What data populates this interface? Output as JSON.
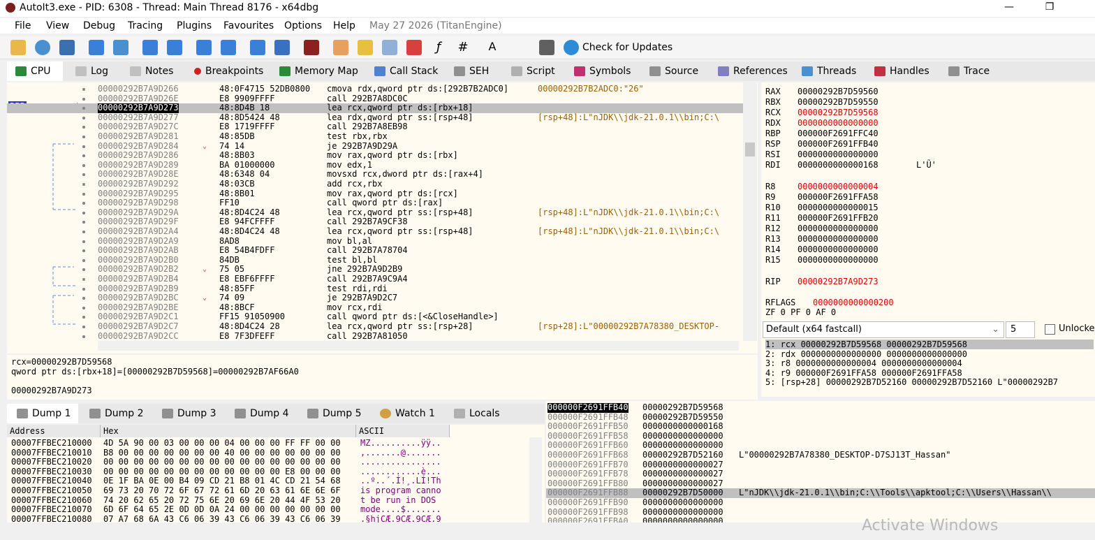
{
  "window": {
    "title": "AutoIt3.exe - PID: 6308 - Thread: Main Thread 8176 - x64dbg",
    "minimize": "—",
    "restore": "❐",
    "close": "✕"
  },
  "menu": [
    "File",
    "View",
    "Debug",
    "Tracing",
    "Plugins",
    "Favourites",
    "Options",
    "Help"
  ],
  "build_info": "May 27 2026 (TitanEngine)",
  "toolbar": {
    "check_updates": "Check for Updates"
  },
  "tabs": [
    "CPU",
    "Log",
    "Notes",
    "Breakpoints",
    "Memory Map",
    "Call Stack",
    "SEH",
    "Script",
    "Symbols",
    "Source",
    "References",
    "Threads",
    "Handles",
    "Trace"
  ],
  "rip_label": "RIP",
  "disasm": [
    {
      "addr": "00000292B7A9D266",
      "bytes": "48:0F4715 52DB0800",
      "ins": "cmova rdx,qword ptr ds:[292B7B2ADC0]",
      "cmt": "00000292B7B2ADC0:\"26\""
    },
    {
      "addr": "00000292B7A9D26E",
      "bytes": "E8 9909FFFF",
      "ins": "call 292B7A8DC0C",
      "cmt": ""
    },
    {
      "addr": "00000292B7A9D273",
      "bytes": "48:8D4B 18",
      "ins": "lea rcx,qword ptr ds:[rbx+18]",
      "cmt": ""
    },
    {
      "addr": "00000292B7A9D277",
      "bytes": "48:8D5424 48",
      "ins": "lea rdx,qword ptr ss:[rsp+48]",
      "cmt": "[rsp+48]:L\"nJDK\\\\jdk-21.0.1\\\\bin;C:\\"
    },
    {
      "addr": "00000292B7A9D27C",
      "bytes": "E8 1719FFFF",
      "ins": "call 292B7A8EB98",
      "cmt": ""
    },
    {
      "addr": "00000292B7A9D281",
      "bytes": "48:85DB",
      "ins": "test rbx,rbx",
      "cmt": ""
    },
    {
      "addr": "00000292B7A9D284",
      "bytes": "74 14",
      "ins": "je 292B7A9D29A",
      "cmt": ""
    },
    {
      "addr": "00000292B7A9D286",
      "bytes": "48:8B03",
      "ins": "mov rax,qword ptr ds:[rbx]",
      "cmt": ""
    },
    {
      "addr": "00000292B7A9D289",
      "bytes": "BA 01000000",
      "ins": "mov edx,1",
      "cmt": ""
    },
    {
      "addr": "00000292B7A9D28E",
      "bytes": "48:6348 04",
      "ins": "movsxd rcx,dword ptr ds:[rax+4]",
      "cmt": ""
    },
    {
      "addr": "00000292B7A9D292",
      "bytes": "48:03CB",
      "ins": "add rcx,rbx",
      "cmt": ""
    },
    {
      "addr": "00000292B7A9D295",
      "bytes": "48:8B01",
      "ins": "mov rax,qword ptr ds:[rcx]",
      "cmt": ""
    },
    {
      "addr": "00000292B7A9D298",
      "bytes": "FF10",
      "ins": "call qword ptr ds:[rax]",
      "cmt": ""
    },
    {
      "addr": "00000292B7A9D29A",
      "bytes": "48:8D4C24 48",
      "ins": "lea rcx,qword ptr ss:[rsp+48]",
      "cmt": "[rsp+48]:L\"nJDK\\\\jdk-21.0.1\\\\bin;C:\\"
    },
    {
      "addr": "00000292B7A9D29F",
      "bytes": "E8 94FCFFFF",
      "ins": "call 292B7A9CF38",
      "cmt": ""
    },
    {
      "addr": "00000292B7A9D2A4",
      "bytes": "48:8D4C24 48",
      "ins": "lea rcx,qword ptr ss:[rsp+48]",
      "cmt": "[rsp+48]:L\"nJDK\\\\jdk-21.0.1\\\\bin;C:\\"
    },
    {
      "addr": "00000292B7A9D2A9",
      "bytes": "8AD8",
      "ins": "mov bl,al",
      "cmt": ""
    },
    {
      "addr": "00000292B7A9D2AB",
      "bytes": "E8 54B4FDFF",
      "ins": "call 292B7A78704",
      "cmt": ""
    },
    {
      "addr": "00000292B7A9D2B0",
      "bytes": "84DB",
      "ins": "test bl,bl",
      "cmt": ""
    },
    {
      "addr": "00000292B7A9D2B2",
      "bytes": "75 05",
      "ins": "jne 292B7A9D2B9",
      "cmt": ""
    },
    {
      "addr": "00000292B7A9D2B4",
      "bytes": "E8 EBF6FFFF",
      "ins": "call 292B7A9C9A4",
      "cmt": ""
    },
    {
      "addr": "00000292B7A9D2B9",
      "bytes": "48:85FF",
      "ins": "test rdi,rdi",
      "cmt": ""
    },
    {
      "addr": "00000292B7A9D2BC",
      "bytes": "74 09",
      "ins": "je 292B7A9D2C7",
      "cmt": ""
    },
    {
      "addr": "00000292B7A9D2BE",
      "bytes": "48:8BCF",
      "ins": "mov rcx,rdi",
      "cmt": ""
    },
    {
      "addr": "00000292B7A9D2C1",
      "bytes": "FF15 91050900",
      "ins": "call qword ptr ds:[<&CloseHandle>]",
      "cmt": ""
    },
    {
      "addr": "00000292B7A9D2C7",
      "bytes": "48:8D4C24 28",
      "ins": "lea rcx,qword ptr ss:[rsp+28]",
      "cmt": "[rsp+28]:L\"00000292B7A78380_DESKTOP-"
    },
    {
      "addr": "00000292B7A9D2CC",
      "bytes": "E8 7F3DFEFF",
      "ins": "call 292B7A81050",
      "cmt": ""
    }
  ],
  "registers": [
    {
      "name": "RAX",
      "value": "00000292B7D59560",
      "extra": ""
    },
    {
      "name": "RBX",
      "value": "00000292B7D59550",
      "extra": ""
    },
    {
      "name": "RCX",
      "value": "00000292B7D59568",
      "extra": ""
    },
    {
      "name": "RDX",
      "value": "0000000000000000",
      "extra": ""
    },
    {
      "name": "RBP",
      "value": "000000F2691FFC40",
      "extra": ""
    },
    {
      "name": "RSP",
      "value": "000000F2691FFB40",
      "extra": ""
    },
    {
      "name": "RSI",
      "value": "0000000000000000",
      "extra": ""
    },
    {
      "name": "RDI",
      "value": "0000000000000168",
      "extra": "L'Ũ'"
    },
    {
      "name": "R8",
      "value": "0000000000000004",
      "extra": ""
    },
    {
      "name": "R9",
      "value": "000000F2691FFA58",
      "extra": ""
    },
    {
      "name": "R10",
      "value": "0000000000000015",
      "extra": ""
    },
    {
      "name": "R11",
      "value": "000000F2691FFB20",
      "extra": ""
    },
    {
      "name": "R12",
      "value": "0000000000000000",
      "extra": ""
    },
    {
      "name": "R13",
      "value": "0000000000000000",
      "extra": ""
    },
    {
      "name": "R14",
      "value": "0000000000000000",
      "extra": ""
    },
    {
      "name": "R15",
      "value": "0000000000000000",
      "extra": ""
    },
    {
      "name": "RIP",
      "value": "00000292B7A9D273",
      "extra": ""
    },
    {
      "name": "RFLAGS",
      "value": "0000000000000200",
      "extra": ""
    }
  ],
  "flags_line": "ZF 0  PF 0  AF 0",
  "callconv": {
    "select": "Default (x64 fastcall)",
    "count": "5",
    "unlocked": "Unlocked",
    "args": [
      "1: rcx 00000292B7D59568 00000292B7D59568",
      "2: rdx 0000000000000000 0000000000000000",
      "3: r8 0000000000000004 0000000000000004",
      "4: r9 000000F2691FFA58 000000F2691FFA58",
      "5: [rsp+28] 00000292B7D52160 00000292B7D52160 L\"00000292B7"
    ]
  },
  "info": [
    "rcx=00000292B7D59568",
    "qword ptr ds:[rbx+18]=[00000292B7D59568]=00000292B7AF66A0",
    "",
    "00000292B7A9D273"
  ],
  "dump_tabs": [
    "Dump 1",
    "Dump 2",
    "Dump 3",
    "Dump 4",
    "Dump 5",
    "Watch 1",
    "Locals"
  ],
  "dump_headers": {
    "address": "Address",
    "hex": "Hex",
    "ascii": "ASCII"
  },
  "dump": [
    {
      "addr": "00007FFBEC210000",
      "hex": "4D 5A 90 00 03 00 00 00 04 00 00 00 FF FF 00 00",
      "ascii": "MZ..........ÿÿ.."
    },
    {
      "addr": "00007FFBEC210010",
      "hex": "B8 00 00 00 00 00 00 00 40 00 00 00 00 00 00 00",
      "ascii": ",.......@......."
    },
    {
      "addr": "00007FFBEC210020",
      "hex": "00 00 00 00 00 00 00 00 00 00 00 00 00 00 00 00",
      "ascii": "................"
    },
    {
      "addr": "00007FFBEC210030",
      "hex": "00 00 00 00 00 00 00 00 00 00 00 00 E8 00 00 00",
      "ascii": "............è..."
    },
    {
      "addr": "00007FFBEC210040",
      "hex": "0E 1F BA 0E 00 B4 09 CD 21 B8 01 4C CD 21 54 68",
      "ascii": "..º..´.Í!¸.LÍ!Th"
    },
    {
      "addr": "00007FFBEC210050",
      "hex": "69 73 20 70 72 6F 67 72 61 6D 20 63 61 6E 6E 6F",
      "ascii": "is program canno"
    },
    {
      "addr": "00007FFBEC210060",
      "hex": "74 20 62 65 20 72 75 6E 20 69 6E 20 44 4F 53 20",
      "ascii": "t be run in DOS "
    },
    {
      "addr": "00007FFBEC210070",
      "hex": "6D 6F 64 65 2E 0D 0D 0A 24 00 00 00 00 00 00 00",
      "ascii": "mode....$......."
    },
    {
      "addr": "00007FFBEC210080",
      "hex": "07 A7 68 6A 43 C6 06 39 43 C6 06 39 43 C6 06 39",
      "ascii": ".§hjCÆ.9CÆ.9CÆ.9"
    }
  ],
  "stack": [
    {
      "addr": "000000F2691FFB40",
      "val": "00000292B7D59568",
      "cmt": ""
    },
    {
      "addr": "000000F2691FFB48",
      "val": "00000292B7D59550",
      "cmt": ""
    },
    {
      "addr": "000000F2691FFB50",
      "val": "0000000000000168",
      "cmt": ""
    },
    {
      "addr": "000000F2691FFB58",
      "val": "0000000000000000",
      "cmt": ""
    },
    {
      "addr": "000000F2691FFB60",
      "val": "0000000000000000",
      "cmt": ""
    },
    {
      "addr": "000000F2691FFB68",
      "val": "00000292B7D52160",
      "cmt": "L\"00000292B7A78380_DESKTOP-D7SJ13T_Hassan\""
    },
    {
      "addr": "000000F2691FFB70",
      "val": "0000000000000027",
      "cmt": ""
    },
    {
      "addr": "000000F2691FFB78",
      "val": "0000000000000027",
      "cmt": ""
    },
    {
      "addr": "000000F2691FFB80",
      "val": "0000000000000027",
      "cmt": ""
    },
    {
      "addr": "000000F2691FFB88",
      "val": "00000292B7D50000",
      "cmt": "L\"nJDK\\\\jdk-21.0.1\\\\bin;C:\\\\Tools\\\\apktool;C:\\\\Users\\\\Hassan\\\\"
    },
    {
      "addr": "000000F2691FFB90",
      "val": "0000000000000000",
      "cmt": ""
    },
    {
      "addr": "000000F2691FFB98",
      "val": "0000000000000000",
      "cmt": ""
    },
    {
      "addr": "000000F2691FFBA0",
      "val": "0000000000000000",
      "cmt": ""
    }
  ],
  "watermark": "Activate Windows",
  "colors": {
    "rip_arrow": "#3333cc",
    "highlight": "#ffff00",
    "selected_row": "#c0c0c0",
    "panel_bg": "#fffbf0",
    "reg_changed": "#e00000",
    "comment": "#a06000"
  }
}
